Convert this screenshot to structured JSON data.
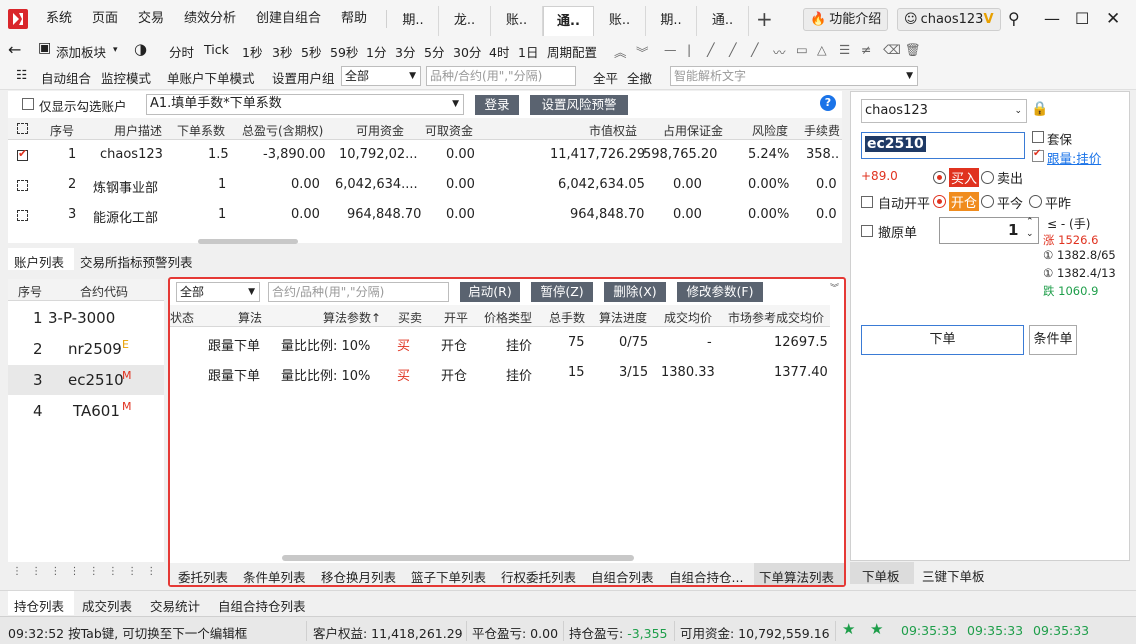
{
  "menu": [
    "系统",
    "页面",
    "交易",
    "绩效分析",
    "创建自组合",
    "帮助"
  ],
  "window_tabs": [
    "期..",
    "龙..",
    "账..",
    "通..",
    "账..",
    "期..",
    "通.."
  ],
  "active_tab_index": 3,
  "plus": "+",
  "feature_btn": "功能介绍",
  "user_btn": "chaos123",
  "vip": "V",
  "toolbar1": {
    "add_block": "添加板块",
    "items": [
      "分时",
      "Tick",
      "1秒",
      "3秒",
      "5秒",
      "59秒",
      "1分",
      "3分",
      "5分",
      "30分",
      "4时",
      "1日",
      "周期配置"
    ]
  },
  "toolbar2": {
    "auto_combo": "自动组合",
    "monitor": "监控模式",
    "single_order": "单账户下单模式",
    "set_group": "设置用户组",
    "group_value": "全部",
    "contract_placeholder": "品种/合约(用\",\"分隔)",
    "close_all": "全平",
    "cancel_all": "全撤",
    "smart_placeholder": "智能解析文字"
  },
  "accounts": {
    "only_show_checked": "仅显示勾选账户",
    "mode": "A1.填单手数*下单系数",
    "login": "登录",
    "risk": "设置风险预警",
    "headers": [
      "序号",
      "用户描述",
      "下单系数",
      "总盈亏(含期权)",
      "可用资金",
      "可取资金",
      "市值权益",
      "占用保证金",
      "风险度",
      "手续费"
    ],
    "rows": [
      [
        "1",
        "chaos123",
        "1.5",
        "-3,890.00",
        "10,792,02...",
        "0.00",
        "11,417,726.29",
        "598,765.20",
        "5.24%",
        "358.."
      ],
      [
        "2",
        "炼钢事业部",
        "1",
        "0.00",
        "6,042,634....",
        "0.00",
        "6,042,634.05",
        "0.00",
        "0.00%",
        "0.0"
      ],
      [
        "3",
        "能源化工部",
        "1",
        "0.00",
        "964,848.70",
        "0.00",
        "964,848.70",
        "0.00",
        "0.00%",
        "0.0"
      ]
    ],
    "tabs": [
      "账户列表",
      "交易所指标预警列表"
    ]
  },
  "contracts": {
    "headers": [
      "序号",
      "合约代码"
    ],
    "rows": [
      [
        "1",
        "3-P-3000",
        ""
      ],
      [
        "2",
        "nr2509",
        "E"
      ],
      [
        "3",
        "ec2510",
        "M"
      ],
      [
        "4",
        "TA601",
        "M"
      ]
    ]
  },
  "algo": {
    "filter": "全部",
    "contract_placeholder": "合约/品种(用\",\"分隔)",
    "buttons": [
      "启动(R)",
      "暂停(Z)",
      "删除(X)",
      "修改参数(F)"
    ],
    "headers": [
      "状态",
      "算法",
      "算法参数↑",
      "买卖",
      "开平",
      "价格类型",
      "总手数",
      "算法进度",
      "成交均价",
      "市场参考成交均价"
    ],
    "rows": [
      [
        "",
        "跟量下单",
        "量比比例: 10%",
        "买",
        "开仓",
        "挂价",
        "75",
        "0/75",
        "-",
        "12697.5"
      ],
      [
        "",
        "跟量下单",
        "量比比例: 10%",
        "买",
        "开仓",
        "挂价",
        "15",
        "3/15",
        "1380.33",
        "1377.40"
      ]
    ],
    "tabs": [
      "委托列表",
      "条件单列表",
      "移仓换月列表",
      "篮子下单列表",
      "行权委托列表",
      "自组合列表",
      "自组合持仓...",
      "下单算法列表"
    ]
  },
  "order": {
    "account": "chaos123",
    "contract": "ec2510",
    "hedge": "套保",
    "follow": "跟量:挂价",
    "change": "+89.0",
    "buy": "买入",
    "sell": "卖出",
    "auto_open_close": "自动开平",
    "open": "开仓",
    "close_today": "平今",
    "close_yest": "平昨",
    "cancel_orig": "撤原单",
    "qty": "1",
    "limit": "≤ - (手)",
    "limit_up": "涨 1526.6",
    "ask": "1382.8/65",
    "bid": "1382.4/13",
    "limit_down": "跌 1060.9",
    "place": "下单",
    "cond": "条件单",
    "tabs": [
      "下单板",
      "三键下单板"
    ]
  },
  "bottom_tabs": [
    "持仓列表",
    "成交列表",
    "交易统计",
    "自组合持仓列表"
  ],
  "status": {
    "hint": "09:32:52 按Tab键, 可切换至下一个编辑框",
    "equity": "客户权益: 11,418,261.29",
    "close_pnl": "平仓盈亏: 0.00",
    "pos_pnl_label": "持仓盈亏: ",
    "pos_pnl": "-3,355",
    "available": "可用资金: 10,792,559.16",
    "times": [
      "09:35:33",
      "09:35:33",
      "09:35:33"
    ]
  },
  "colors": {
    "accent_red": "#e0321f",
    "btn_gray": "#5a6370",
    "profit_green": "#1e9e4a"
  }
}
